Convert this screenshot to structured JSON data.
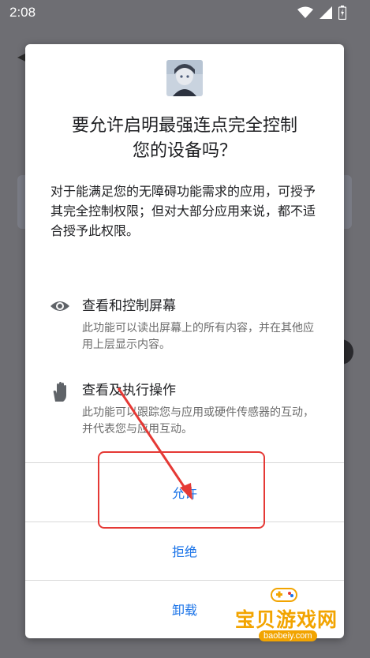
{
  "status_bar": {
    "time": "2:08"
  },
  "dialog": {
    "title_line1": "要允许启明最强连点完全控制",
    "title_line2": "您的设备吗？",
    "description": "对于能满足您的无障碍功能需求的应用，可授予其完全控制权限；但对大部分应用来说，都不适合授予此权限。",
    "permissions": [
      {
        "icon": "eye-icon",
        "title": "查看和控制屏幕",
        "desc": "此功能可以读出屏幕上的所有内容，并在其他应用上层显示内容。"
      },
      {
        "icon": "hand-icon",
        "title": "查看及执行操作",
        "desc": "此功能可以跟踪您与应用或硬件传感器的互动，并代表您与应用互动。"
      }
    ],
    "buttons": {
      "allow": "允许",
      "deny": "拒绝",
      "uninstall": "卸载"
    }
  },
  "watermark": {
    "name": "宝贝游戏网",
    "url": "baobeiy.com"
  },
  "colors": {
    "accent": "#1a73e8",
    "annotation": "#e53935",
    "watermark": "#f2a400"
  }
}
